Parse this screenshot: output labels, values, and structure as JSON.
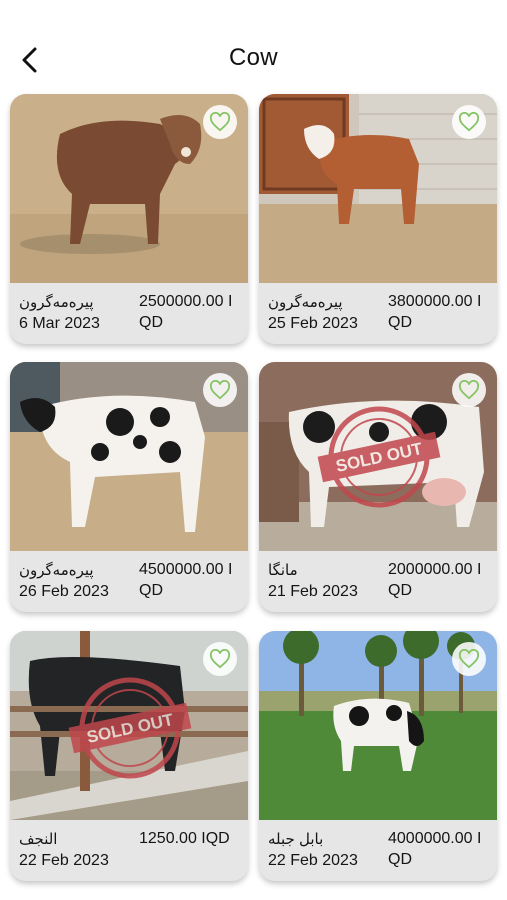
{
  "header": {
    "title": "Cow",
    "back_icon": "chevron-left-icon"
  },
  "listings": [
    {
      "location": "پیرەمەگرون",
      "date": "6 Mar 2023",
      "price": "2500000.00 IQD",
      "sold_out": false
    },
    {
      "location": "پیرەمەگرون",
      "date": "25 Feb 2023",
      "price": "3800000.00 IQD",
      "sold_out": false
    },
    {
      "location": "پیرەمەگرون",
      "date": "26 Feb 2023",
      "price": "4500000.00 IQD",
      "sold_out": false
    },
    {
      "location": "مانگا",
      "date": "21 Feb 2023",
      "price": "2000000.00 IQD",
      "sold_out": true
    },
    {
      "location": "النجف",
      "date": "22 Feb 2023",
      "price": "1250.00 IQD",
      "sold_out": true
    },
    {
      "location": "بابل جبله",
      "date": "22 Feb 2023",
      "price": "4000000.00 IQD",
      "sold_out": false
    }
  ],
  "stamp": {
    "text": "SOLD OUT",
    "color": "#c0474d"
  },
  "colors": {
    "card_bg": "#e6e6e6",
    "heart": "#86c466"
  }
}
